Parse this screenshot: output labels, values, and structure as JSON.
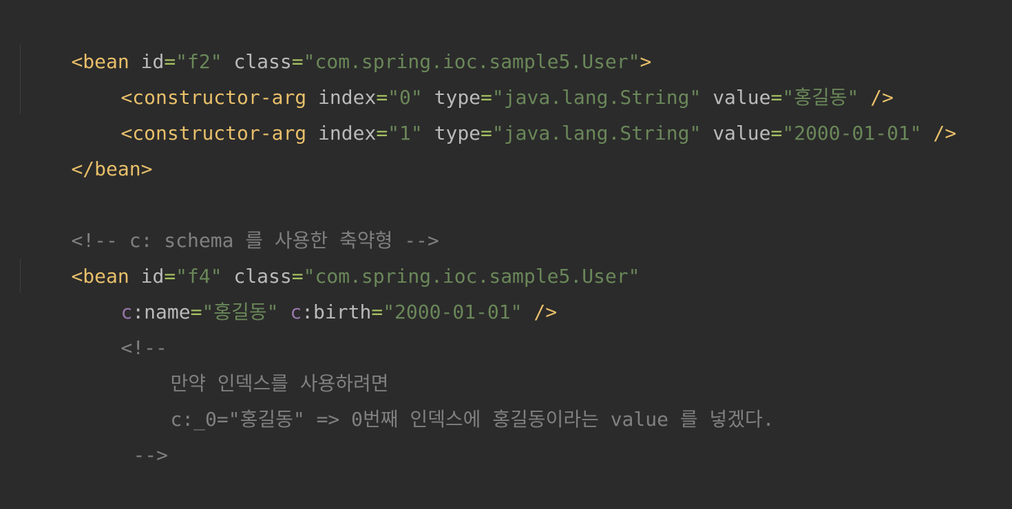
{
  "colors": {
    "background": "#2b2b2b",
    "tag": "#e8bf6a",
    "attribute": "#bababa",
    "string": "#6a8759",
    "namespace": "#9876aa",
    "comment": "#808080"
  },
  "lines": {
    "l1": {
      "open": "<bean",
      "a1": "id",
      "e1": "=",
      "v1": "\"f2\"",
      "a2": "class",
      "e2": "=",
      "v2": "\"com.spring.ioc.sample5.User\"",
      "close": ">"
    },
    "l2": {
      "open": "<constructor-arg",
      "a1": "index",
      "e1": "=",
      "v1": "\"0\"",
      "a2": "type",
      "e2": "=",
      "v2": "\"java.lang.String\"",
      "a3": "value",
      "e3": "=",
      "v3": "\"홍길동\"",
      "close": "/>"
    },
    "l3": {
      "open": "<constructor-arg",
      "a1": "index",
      "e1": "=",
      "v1": "\"1\"",
      "a2": "type",
      "e2": "=",
      "v2": "\"java.lang.String\"",
      "a3": "value",
      "e3": "=",
      "v3": "\"2000-01-01\"",
      "close": "/>"
    },
    "l4": {
      "close_tag": "</bean>"
    },
    "l6": {
      "comment": "<!-- c: schema 를 사용한 축약형 -->"
    },
    "l7": {
      "open": "<bean",
      "a1": "id",
      "e1": "=",
      "v1": "\"f4\"",
      "a2": "class",
      "e2": "=",
      "v2": "\"com.spring.ioc.sample5.User\""
    },
    "l8": {
      "ns1": "c",
      "a1": ":name",
      "e1": "=",
      "v1": "\"홍길동\"",
      "ns2": "c",
      "a2": ":birth",
      "e2": "=",
      "v2": "\"2000-01-01\"",
      "close": "/>"
    },
    "l9": {
      "comment": "<!--"
    },
    "l10": {
      "comment": "만약 인덱스를 사용하려면"
    },
    "l11": {
      "comment": "c:_0=\"홍길동\" => 0번째 인덱스에 홍길동이라는 value 를 넣겠다."
    },
    "l12": {
      "comment": "-->"
    }
  }
}
